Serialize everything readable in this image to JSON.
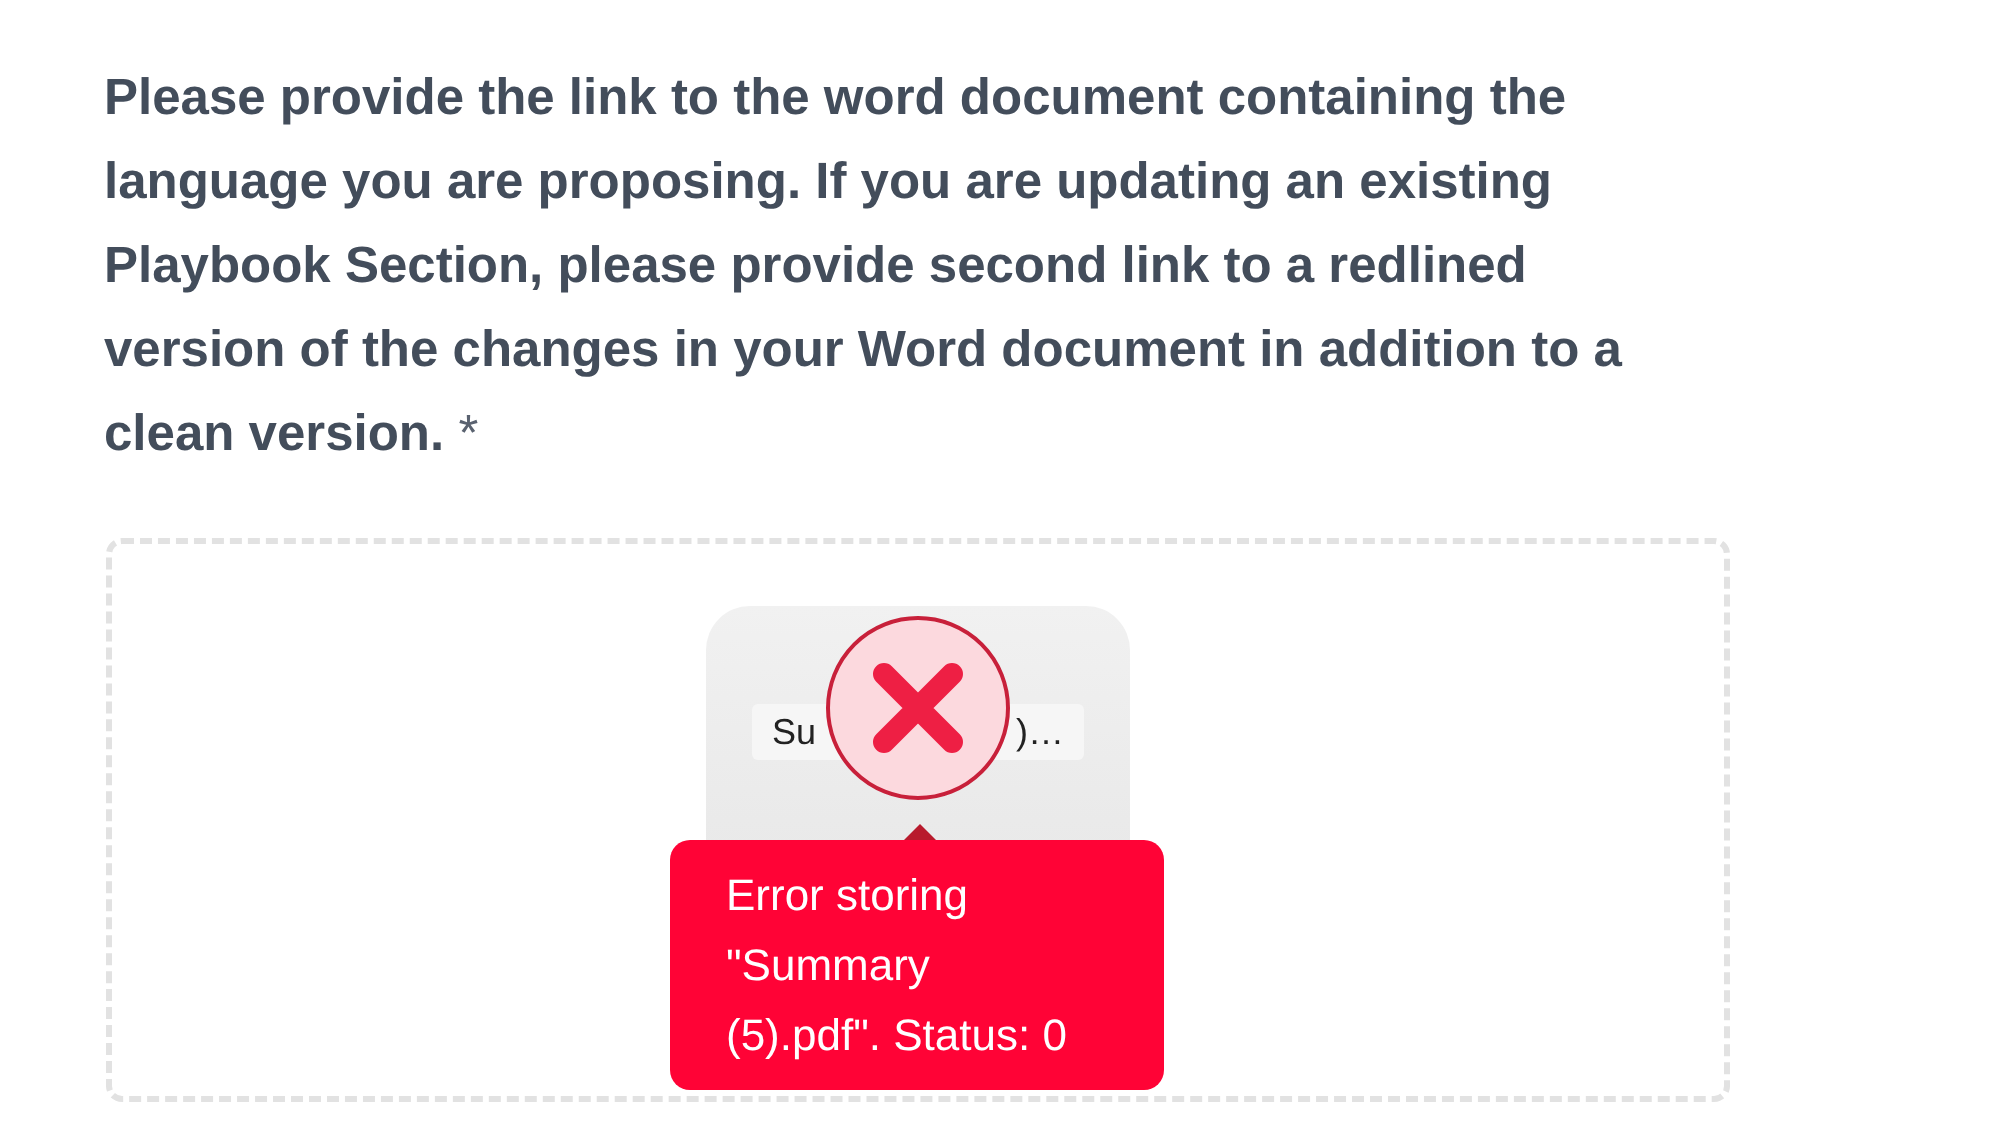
{
  "question": {
    "text": "Please provide the link to the word document containing the language you are proposing. If you are updating an existing Playbook Section, please provide second link to a redlined version of the changes in your Word document in addition to a clean version.",
    "required_mark": "*"
  },
  "upload": {
    "file_name_parts": [
      "Su",
      ")…"
    ],
    "failed": true,
    "error_message": "Error storing \"Summary (5).pdf\". Status: 0"
  }
}
